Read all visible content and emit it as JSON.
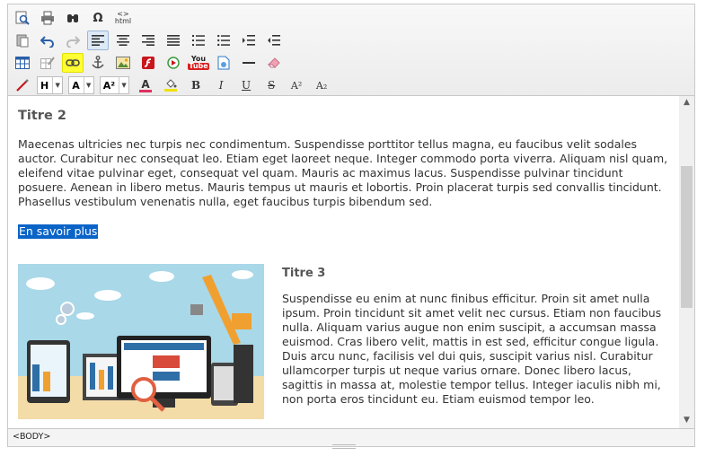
{
  "toolbar": {
    "row1": [
      "preview-icon",
      "print-icon",
      "find-icon",
      "special-char-icon",
      "html-icon"
    ],
    "omega": "Ω",
    "html_top": "<>",
    "html_bottom": "html",
    "header_select": "H",
    "font_select": "A",
    "size_select": "A²",
    "bold": "B",
    "italic": "I",
    "underline": "U",
    "strike": "S",
    "superscript": "A²",
    "subscript": "A₂",
    "youtube_top": "You",
    "youtube_bottom": "Tube"
  },
  "content": {
    "heading": "Titre 2",
    "paragraph": "Maecenas ultricies nec turpis nec condimentum. Suspendisse porttitor tellus magna, eu faucibus velit sodales auctor. Curabitur nec consequat leo. Etiam eget laoreet neque. Integer commodo porta viverra. Aliquam nisl quam, eleifend vitae pulvinar eget, consequat vel quam. Mauris ac maximus lacus. Suspendisse pulvinar tincidunt posuere. Aenean in libero metus. Mauris tempus ut mauris et lobortis. Proin placerat turpis sed convallis tincidunt. Phasellus vestibulum venenatis nulla, eget faucibus turpis bibendum sed.",
    "link": "En savoir plus",
    "subheading": "Titre 3",
    "side_paragraph": "Suspendisse eu enim at nunc finibus efficitur. Proin sit amet nulla ipsum. Proin tincidunt sit amet velit nec cursus. Etiam non faucibus nulla. Aliquam varius augue non enim suscipit, a accumsan massa euismod. Cras libero velit, mattis in est sed, efficitur congue ligula. Duis arcu nunc, facilisis vel dui quis, suscipit varius nisl. Curabitur ullamcorper turpis ut neque varius ornare. Donec libero lacus, sagittis in massa at, molestie tempor tellus. Integer iaculis nibh mi, non porta eros tincidunt eu. Etiam euismod tempor leo."
  },
  "status": {
    "path": "<BODY>"
  },
  "colors": {
    "selection": "#0a64c8",
    "toolbar_bg": "#f0f0f0",
    "active_button": "#dde9f6",
    "highlight_button": "#ffff33"
  }
}
